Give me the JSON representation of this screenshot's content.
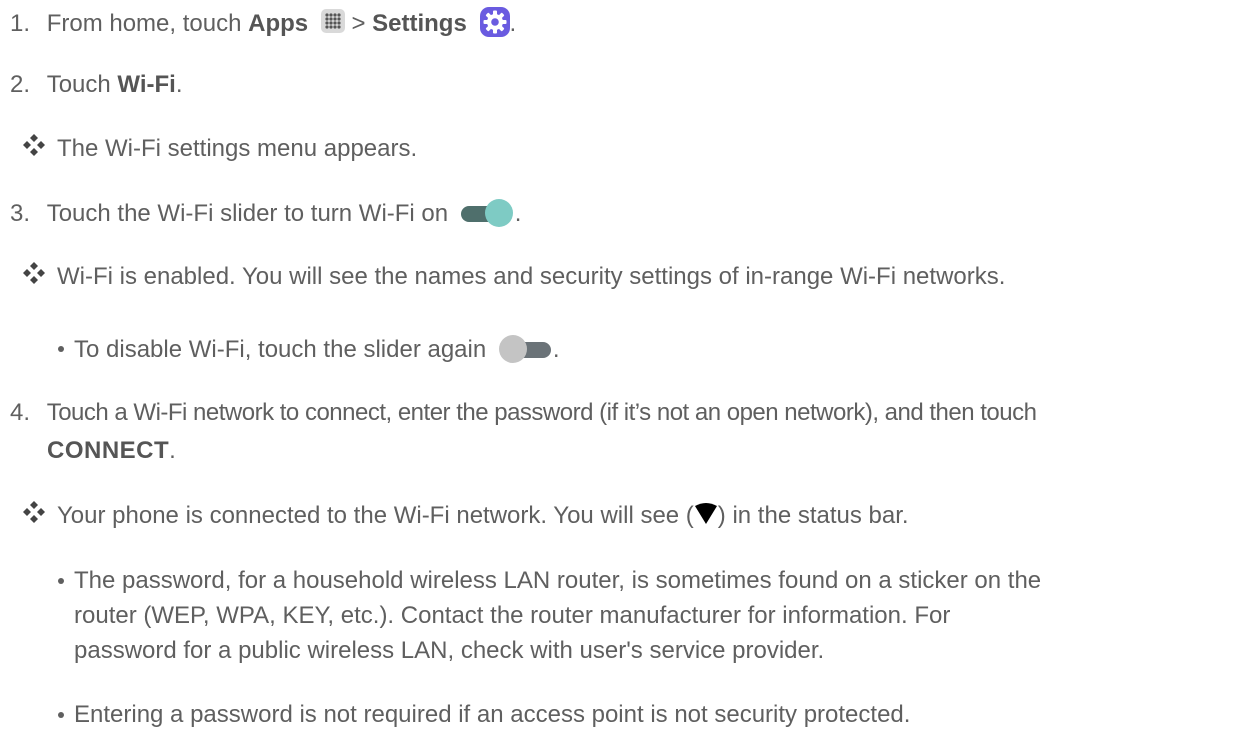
{
  "steps": [
    {
      "num": "1.",
      "pre": "From home, touch ",
      "bold1": "Apps",
      "mid": " > ",
      "bold2": "Settings",
      "post": "."
    },
    {
      "num": "2.",
      "pre": "Touch ",
      "bold": "Wi-Fi",
      "post": "."
    },
    {
      "num": "3.",
      "pre": "Touch the Wi-Fi slider to turn Wi-Fi on ",
      "post": "."
    },
    {
      "num": "4.",
      "line1": "Touch a Wi-Fi network to connect, enter the password (if it’s not an open network), and then touch",
      "bold": "CONNECT",
      "post": "."
    }
  ],
  "results": {
    "r2": "The Wi-Fi settings menu appears.",
    "r3": "Wi-Fi is enabled. You will see the names and security settings of in-range Wi-Fi networks.",
    "r4_pre": "Your phone is connected to the Wi-Fi network. You will see (",
    "r4_post": ") in the status bar."
  },
  "notes": {
    "disable_pre": "To disable Wi-Fi, touch the slider again ",
    "disable_post": ".",
    "password_lines": [
      "The password, for a household wireless LAN router, is sometimes found on a sticker on the",
      "router (WEP, WPA, KEY, etc.). Contact the router manufacturer for information. For",
      "password for a public wireless LAN, check with user's service provider."
    ],
    "not_required": "Entering a password is not required if an access point is not security protected."
  },
  "icons": {
    "apps": "apps-grid-icon",
    "settings": "settings-gear-icon",
    "toggle_on": "toggle-on-icon",
    "toggle_off": "toggle-off-icon",
    "wifi": "wifi-signal-icon",
    "result": "four-diamond-bullet-icon"
  },
  "colors": {
    "text": "#5f5f5f",
    "settings_bg": "#6a5be0",
    "toggle_on_knob": "#7ecbc4",
    "toggle_on_track": "#4f6f6c",
    "toggle_off_knob": "#c4c4c4",
    "toggle_off_track": "#6b7378"
  }
}
